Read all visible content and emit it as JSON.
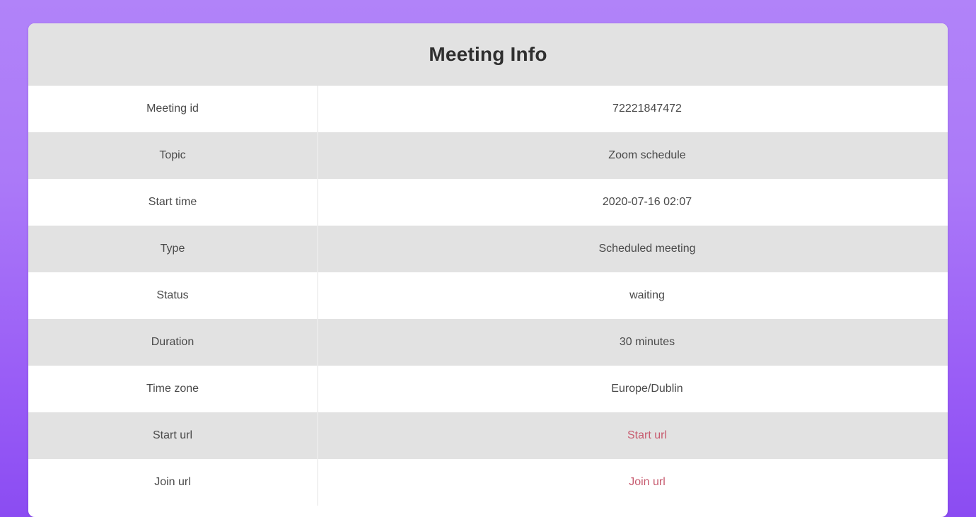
{
  "card": {
    "title": "Meeting Info"
  },
  "table": {
    "rows": [
      {
        "label": "Meeting id",
        "value": "72221847472",
        "is_link": false
      },
      {
        "label": "Topic",
        "value": "Zoom schedule",
        "is_link": false
      },
      {
        "label": "Start time",
        "value": "2020-07-16 02:07",
        "is_link": false
      },
      {
        "label": "Type",
        "value": "Scheduled meeting",
        "is_link": false
      },
      {
        "label": "Status",
        "value": "waiting",
        "is_link": false
      },
      {
        "label": "Duration",
        "value": "30 minutes",
        "is_link": false
      },
      {
        "label": "Time zone",
        "value": "Europe/Dublin",
        "is_link": false
      },
      {
        "label": "Start url",
        "value": "Start url",
        "is_link": true
      },
      {
        "label": "Join url",
        "value": "Join url",
        "is_link": true
      }
    ]
  },
  "theme": {
    "background_top": "#b183f9",
    "background_bottom": "#8b4cf2",
    "header_bg": "#e2e2e2",
    "stripe_bg": "#e2e2e2",
    "link_color": "#c75a6e",
    "text_color": "#4a4a4a",
    "title_color": "#2f2f2f"
  }
}
